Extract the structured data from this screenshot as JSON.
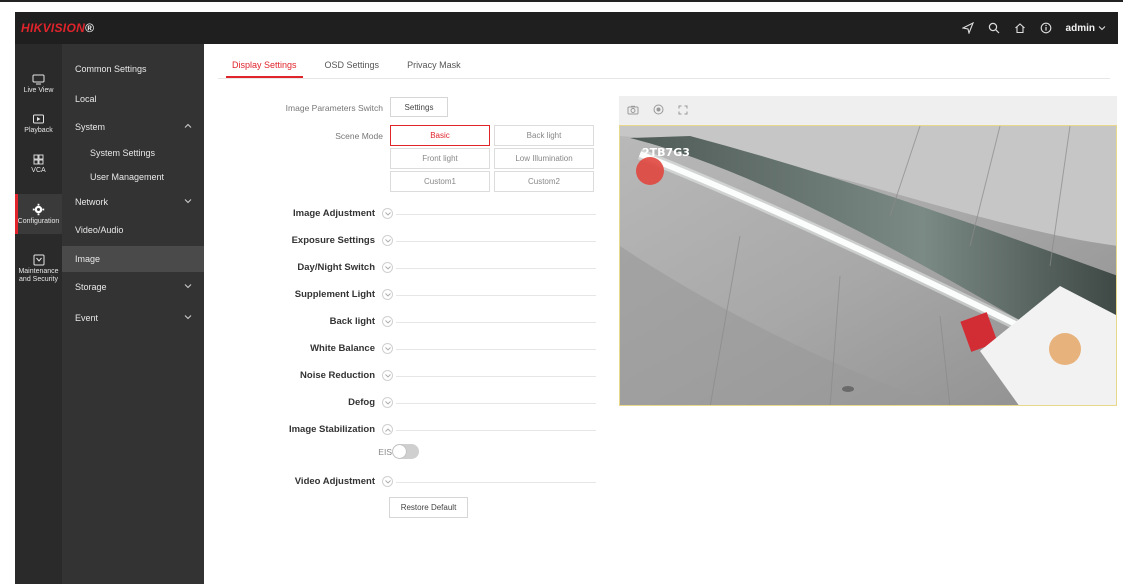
{
  "brand": {
    "logo_red": "HIKVISION",
    "logo_mark": "®"
  },
  "header": {
    "user": "admin"
  },
  "rail": [
    {
      "label": "Live View",
      "icon": "live-view-icon"
    },
    {
      "label": "Playback",
      "icon": "playback-icon"
    },
    {
      "label": "VCA",
      "icon": "vca-icon"
    },
    {
      "label": "Configuration",
      "icon": "gear-icon",
      "active": true
    },
    {
      "label": "Maintenance and Security",
      "icon": "maintenance-icon"
    }
  ],
  "menu": {
    "common": "Common Settings",
    "local": "Local",
    "system": "System",
    "system_settings": "System Settings",
    "user_management": "User Management",
    "network": "Network",
    "video_audio": "Video/Audio",
    "image": "Image",
    "storage": "Storage",
    "event": "Event"
  },
  "tabs": {
    "display": "Display Settings",
    "osd": "OSD Settings",
    "privacy": "Privacy Mask"
  },
  "form": {
    "image_params_label": "Image Parameters Switch",
    "settings_btn": "Settings",
    "scene_mode_label": "Scene Mode",
    "scenes": [
      "Basic",
      "Back light",
      "Front light",
      "Low Illumination",
      "Custom1",
      "Custom2"
    ],
    "selected_scene": "Basic"
  },
  "sections": {
    "image_adjustment": "Image Adjustment",
    "exposure": "Exposure Settings",
    "day_night": "Day/Night Switch",
    "supplement": "Supplement Light",
    "back_light": "Back light",
    "white_balance": "White Balance",
    "noise": "Noise Reduction",
    "defog": "Defog",
    "stabilization": "Image Stabilization",
    "video_adjustment": "Video Adjustment"
  },
  "eis": {
    "label": "EIS",
    "enabled": false
  },
  "restore": "Restore Default",
  "preview": {
    "osd_text": "2TB7G3"
  },
  "colors": {
    "accent": "#e0242b",
    "topbar": "#1f1f1f",
    "rail": "#2a2a2a",
    "submenu": "#333333"
  }
}
